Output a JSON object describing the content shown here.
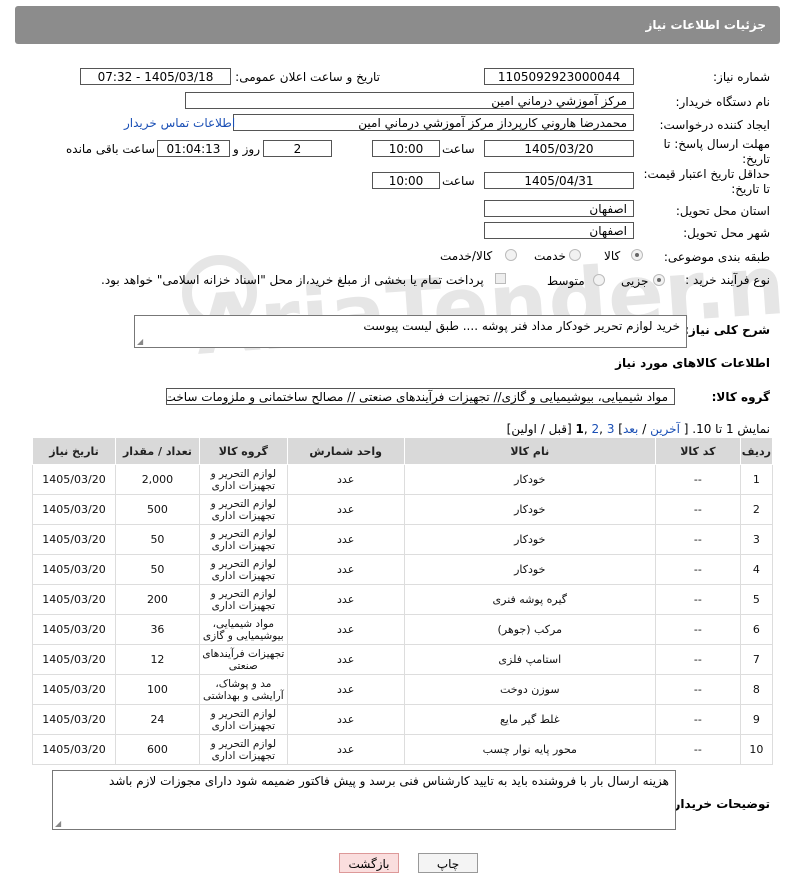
{
  "header": {
    "title": "جزئیات اطلاعات نیاز"
  },
  "form": {
    "need_number_label": "شماره نیاز:",
    "need_number": "1105092923000044",
    "announce_label": "تاریخ و ساعت اعلان عمومی:",
    "announce_value": "1405/03/18 - 07:32",
    "buyer_org_label": "نام دستگاه خریدار:",
    "buyer_org": "مرکز آموزشي درماني امين",
    "creator_label": "ایجاد کننده درخواست:",
    "creator": "محمدرضا هاروني کارپرداز مرکز آموزشي درماني امين",
    "contact_link": "اطلاعات تماس خریدار",
    "deadline_label_1": "مهلت ارسال پاسخ: تا",
    "deadline_label_2": "تاریخ:",
    "deadline_date": "1405/03/20",
    "time_label": "ساعت",
    "deadline_time": "10:00",
    "days_value": "2",
    "days_label": "روز و",
    "remaining_time": "01:04:13",
    "remaining_label": "ساعت باقی مانده",
    "validity_label_1": "حداقل تاریخ اعتبار قیمت:",
    "validity_label_2": "تا تاریخ:",
    "validity_date": "1405/04/31",
    "validity_time": "10:00",
    "province_label": "استان محل تحویل:",
    "province": "اصفهان",
    "city_label": "شهر محل تحویل:",
    "city": "اصفهان",
    "category_label": "طبقه بندی موضوعی:",
    "category_options": [
      "کالا",
      "خدمت",
      "کالا/خدمت"
    ],
    "category_selected": "کالا",
    "process_label": "نوع فرآیند خرید :",
    "process_options": [
      "جزیی",
      "متوسط"
    ],
    "process_selected": "جزیی",
    "payment_note": "پرداخت تمام یا بخشی از مبلغ خرید،از محل \"اسناد خزانه اسلامی\" خواهد بود.",
    "overview_label": "شرح کلی نیاز:",
    "overview": "خرید لوازم تحریر خودکار مداد فنر پوشه .... طبق لیست پیوست",
    "goods_info_title": "اطلاعات کالاهای مورد نیاز",
    "goods_group_label": "گروه کالا:",
    "goods_group": "مواد شیمیایی، بیوشیمیایی و  گازی// تجهیزات فرآیندهای صنعتی // مصالح ساختمانی و ملزومات ساخت و س"
  },
  "pagination": {
    "showing": "نمایش 1 تا 10.",
    "last": "آخرین",
    "next": "بعد",
    "page3": "3",
    "page2": "2",
    "page1": "1",
    "prev_first": "[قبل / اولین]"
  },
  "table": {
    "headers": [
      "ردیف",
      "کد کالا",
      "نام کالا",
      "واحد شمارش",
      "گروه کالا",
      "تعداد / مقدار",
      "تاریخ نیاز"
    ],
    "rows": [
      [
        "1",
        "--",
        "خودکار",
        "عدد",
        "لوازم التحریر و تجهیزات اداری",
        "2,000",
        "1405/03/20"
      ],
      [
        "2",
        "--",
        "خودکار",
        "عدد",
        "لوازم التحریر و تجهیزات اداری",
        "500",
        "1405/03/20"
      ],
      [
        "3",
        "--",
        "خودکار",
        "عدد",
        "لوازم التحریر و تجهیزات اداری",
        "50",
        "1405/03/20"
      ],
      [
        "4",
        "--",
        "خودکار",
        "عدد",
        "لوازم التحریر و تجهیزات اداری",
        "50",
        "1405/03/20"
      ],
      [
        "5",
        "--",
        "گیره پوشه فنری",
        "عدد",
        "لوازم التحریر و تجهیزات اداری",
        "200",
        "1405/03/20"
      ],
      [
        "6",
        "--",
        "مرکب (جوهر)",
        "عدد",
        "مواد شیمیایی، بیوشیمیایی و گازی",
        "36",
        "1405/03/20"
      ],
      [
        "7",
        "--",
        "استامپ فلزی",
        "عدد",
        "تجهیزات فرآیندهای صنعتی",
        "12",
        "1405/03/20"
      ],
      [
        "8",
        "--",
        "سوزن دوخت",
        "عدد",
        "مد و پوشاک، آرایشی و بهداشتی",
        "100",
        "1405/03/20"
      ],
      [
        "9",
        "--",
        "غلط گیر مایع",
        "عدد",
        "لوازم التحریر و تجهیزات اداری",
        "24",
        "1405/03/20"
      ],
      [
        "10",
        "--",
        "محور پایه نوار چسب",
        "عدد",
        "لوازم التحریر و تجهیزات اداری",
        "600",
        "1405/03/20"
      ]
    ]
  },
  "buyer_notes_label": "توضیحات خریدار:",
  "buyer_notes": "هزینه ارسال بار با فروشنده باید به تایید کارشناس فنی برسد و پیش فاکتور ضمیمه شود دارای مجوزات لازم باشد",
  "buttons": {
    "print": "چاپ",
    "back": "بازگشت"
  },
  "watermark": "AriaTender.net"
}
